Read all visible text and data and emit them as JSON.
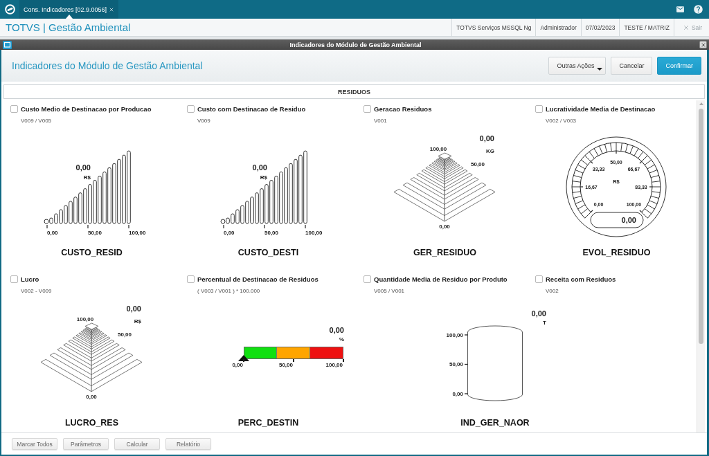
{
  "topbar": {
    "tabs": [
      {
        "label": "Cons. Indicadores [02.9.0056]",
        "selected": true
      }
    ]
  },
  "header": {
    "app_title": "TOTVS | Gestão Ambiental",
    "info": [
      "TOTVS Serviços MSSQL Ng",
      "Administrador",
      "07/02/2023",
      "TESTE / MATRIZ"
    ],
    "exit_label": "Sair"
  },
  "window": {
    "title": "Indicadores do Módulo de Gestão Ambiental"
  },
  "panel": {
    "title": "Indicadores do Módulo de Gestão Ambiental",
    "buttons": [
      {
        "label": "Outras Ações",
        "kind": "menu"
      },
      {
        "label": "Cancelar",
        "kind": "default"
      },
      {
        "label": "Confirmar",
        "kind": "primary"
      }
    ]
  },
  "section": {
    "title": "RESIDUOS"
  },
  "indicators": [
    {
      "title": "Custo Medio de Destinacao por Producao",
      "formula": "V009 / V005",
      "checked": false,
      "name": "CUSTO_RESID",
      "gauge": {
        "kind": "bars",
        "value": "0,00",
        "unit": "R$",
        "scale": [
          "0,00",
          "50,00",
          "100,00"
        ]
      }
    },
    {
      "title": "Custo com Destinacao de Residuo",
      "formula": "V009",
      "checked": false,
      "name": "CUSTO_DESTI",
      "gauge": {
        "kind": "bars",
        "value": "0,00",
        "unit": "R$",
        "scale": [
          "0,00",
          "50,00",
          "100,00"
        ]
      }
    },
    {
      "title": "Geracao Residuos",
      "formula": "V001",
      "checked": false,
      "name": "GER_RESIDUO",
      "gauge": {
        "kind": "pyramid",
        "value": "0,00",
        "unit": "KG",
        "scale": [
          "100,00",
          "50,00",
          "0,00"
        ]
      }
    },
    {
      "title": "Lucratividade Media de Destinacao",
      "formula": "V002 / V003",
      "checked": false,
      "name": "EVOL_RESIDUO",
      "gauge": {
        "kind": "dial",
        "value": "0,00",
        "unit": "R$",
        "scale": [
          "0,00",
          "16,67",
          "33,33",
          "50,00",
          "66,67",
          "83,33",
          "100,00"
        ]
      }
    },
    {
      "title": "Lucro",
      "formula": "V002 - V009",
      "checked": false,
      "name": "LUCRO_RES",
      "gauge": {
        "kind": "pyramid",
        "value": "0,00",
        "unit": "R$",
        "scale": [
          "100,00",
          "50,00",
          "0,00"
        ]
      }
    },
    {
      "title": "Percentual de Destinacao de Residuos",
      "formula": "( V003 / V001 ) * 100.000",
      "checked": false,
      "name": "PERC_DESTIN",
      "gauge": {
        "kind": "linear",
        "value": "0,00",
        "unit": "%",
        "level": 0,
        "scale": [
          "0,00",
          "50,00",
          "100,00"
        ]
      }
    },
    {
      "title": "Quantidade Media de Residuo por Produto",
      "formula": "V005 / V001",
      "checked": false,
      "name": "IND_GER_NAOR",
      "gauge": {
        "kind": "tank",
        "value": "0,00",
        "unit": "T",
        "scale": [
          "100,00",
          "50,00",
          "0,00"
        ]
      }
    },
    {
      "title": "Receita com Residuos",
      "formula": "V002",
      "checked": false
    }
  ],
  "footer": {
    "buttons": [
      "Marcar Todos",
      "Parâmetros",
      "Calcular",
      "Relatório"
    ]
  }
}
